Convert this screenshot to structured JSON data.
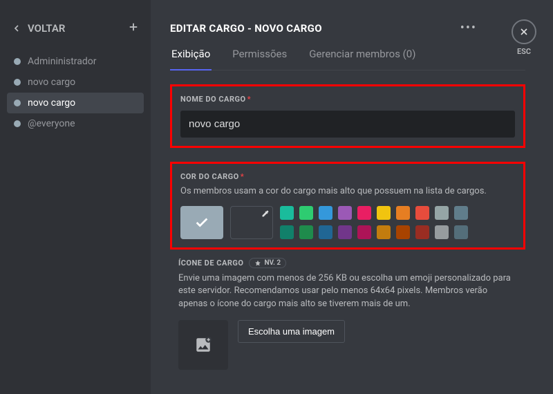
{
  "sidebar": {
    "back_label": "VOLTAR",
    "roles": [
      {
        "label": "Admininistrador"
      },
      {
        "label": "novo cargo"
      },
      {
        "label": "novo cargo"
      },
      {
        "label": "@everyone"
      }
    ]
  },
  "header": {
    "title": "EDITAR CARGO - NOVO CARGO",
    "esc": "ESC"
  },
  "tabs": {
    "display": "Exibição",
    "permissions": "Permissões",
    "members": "Gerenciar membros (0)"
  },
  "role_name": {
    "label": "NOME DO CARGO",
    "value": "novo cargo"
  },
  "role_color": {
    "label": "COR DO CARGO",
    "help": "Os membros usam a cor do cargo mais alto que possuem na lista de cargos.",
    "colors_row1": [
      "#1abc9c",
      "#2ecc71",
      "#3498db",
      "#9b59b6",
      "#e91e63",
      "#f1c40f",
      "#e67e22",
      "#e74c3c",
      "#95a5a6",
      "#607d8b"
    ],
    "colors_row2": [
      "#11806a",
      "#1f8b4c",
      "#206694",
      "#71368a",
      "#ad1457",
      "#c27c0e",
      "#a84300",
      "#992d22",
      "#979c9f",
      "#546e7a"
    ]
  },
  "role_icon": {
    "label": "ÍCONE DE CARGO",
    "badge": "NV. 2",
    "help": "Envie uma imagem com menos de 256 KB ou escolha um emoji personalizado para este servidor. Recomendamos usar pelo menos 64x64 pixels. Membros verão apenas o ícone do cargo mais alto se tiverem mais de um.",
    "choose_button": "Escolha uma imagem"
  }
}
